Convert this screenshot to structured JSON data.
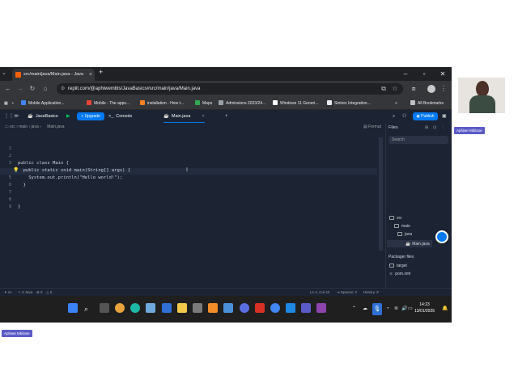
{
  "browser": {
    "tab_title": "src/main/java/Main.java - Java",
    "url": "replit.com/@aphiwembls/JavaBasics#src/main/java/Main.java",
    "bookmarks": [
      "Mobile Application...",
      "Mobile - The apps...",
      "installation - How t...",
      "Maps",
      "Admissions 2023/24...",
      "Windows 11 Generi...",
      "Sintrex Integration..."
    ],
    "all_bookmarks": "All Bookmarks"
  },
  "replit": {
    "project": "JavaBasics",
    "upgrade": "Upgrade",
    "console_tab": "Console",
    "file_tab": "Main.java",
    "publish": "Publish",
    "breadcrumb": [
      "src",
      "main",
      "java",
      "Main.java"
    ],
    "format": "Format"
  },
  "code": {
    "line_numbers": [
      "1",
      "2",
      "3",
      "4",
      "5",
      "6",
      "7",
      "8",
      "9"
    ],
    "lines": [
      "",
      "",
      "public class Main {",
      "  public static void main(String[] args) {",
      "    System.out.println(\"Hello world!\");",
      "  }",
      "",
      "",
      "}"
    ]
  },
  "files": {
    "title": "Files",
    "search_placeholder": "Search",
    "tree": [
      "src",
      "main",
      "java",
      "Main.java"
    ],
    "packager_title": "Packager files",
    "packager": [
      "target",
      "pom.xml"
    ]
  },
  "status": {
    "ai": "AI",
    "java": "3 Java",
    "errors": "0",
    "warnings": "0",
    "position": "Ln 4, Col 43",
    "spaces": "Spaces: 2",
    "history": "History"
  },
  "taskbar": {
    "time": "14:23",
    "date": "13/01/2026"
  },
  "participants": {
    "presenter": "Aphiwe Mbilase",
    "self": "Aphiwe Mbilase"
  },
  "colors": {
    "replit_bg": "#1c2333",
    "accent": "#0079f2",
    "chrome_dark": "#202124",
    "teams_purple": "#5b5bc7"
  }
}
